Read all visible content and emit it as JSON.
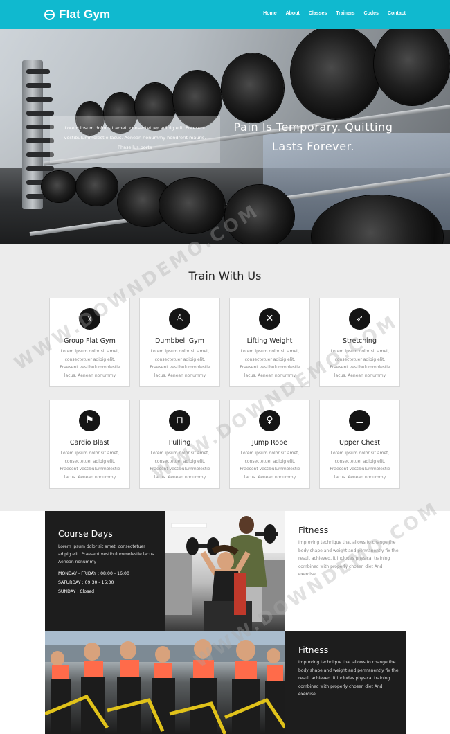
{
  "brand": {
    "name": "Flat Gym",
    "icon": "dumbbell-icon"
  },
  "nav": [
    {
      "label": "Home"
    },
    {
      "label": "About"
    },
    {
      "label": "Classes"
    },
    {
      "label": "Trainers"
    },
    {
      "label": "Codes"
    },
    {
      "label": "Contact"
    }
  ],
  "hero": {
    "box_text": "Lorem ipsum dolor sit amet, consectetuer adipig elit. Praesent vestibulummolestie lacus. Aenean nonummy hendrerit mauris. Phasellus porta",
    "quote_line1": "Pain Is Temporary. Quitting",
    "quote_line2": "Lasts Forever."
  },
  "train": {
    "title": "Train With Us",
    "cards": [
      {
        "title": "Group Flat Gym",
        "icon": "group-workout-icon",
        "glyph": "⚹",
        "text": "Lorem ipsum dolor sit amet, consectetuer adipig elit. Praesent vestibulummolestie lacus. Aenean nonummy"
      },
      {
        "title": "Dumbbell Gym",
        "icon": "dumbbell-person-icon",
        "glyph": "♙",
        "text": "Lorem ipsum dolor sit amet, consectetuer adipig elit. Praesent vestibulummolestie lacus. Aenean nonummy"
      },
      {
        "title": "Lifting Weight",
        "icon": "weightlifting-icon",
        "glyph": "✕",
        "text": "Lorem ipsum dolor sit amet, consectetuer adipig elit. Praesent vestibulummolestie lacus. Aenean nonummy"
      },
      {
        "title": "Stretching",
        "icon": "stretching-icon",
        "glyph": "➶",
        "text": "Lorem ipsum dolor sit amet, consectetuer adipig elit. Praesent vestibulummolestie lacus. Aenean nonummy"
      },
      {
        "title": "Cardio Blast",
        "icon": "treadmill-icon",
        "glyph": "⚑",
        "text": "Lorem ipsum dolor sit amet, consectetuer adipig elit. Praesent vestibulummolestie lacus. Aenean nonummy"
      },
      {
        "title": "Pulling",
        "icon": "pull-up-icon",
        "glyph": "⊓",
        "text": "Lorem ipsum dolor sit amet, consectetuer adipig elit. Praesent vestibulummolestie lacus. Aenean nonummy"
      },
      {
        "title": "Jump Rope",
        "icon": "jump-rope-icon",
        "glyph": "♀",
        "text": "Lorem ipsum dolor sit amet, consectetuer adipig elit. Praesent vestibulummolestie lacus. Aenean nonummy"
      },
      {
        "title": "Upper Chest",
        "icon": "bench-press-icon",
        "glyph": "⚊",
        "text": "Lorem ipsum dolor sit amet, consectetuer adipig elit. Praesent vestibulummolestie lacus. Aenean nonummy"
      }
    ]
  },
  "course": {
    "title": "Course Days",
    "text": "Lorem ipsum dolor sit amet, consectetuer adipig elit. Praesent vestibulummolestie lacus. Aenean nonummy",
    "hours": [
      "MONDAY - FRIDAY : 08:00 - 16:00",
      "SATURDAY : 09:30 - 15:30",
      "SUNDAY : Closed"
    ]
  },
  "fitness1": {
    "title": "Fitness",
    "text": "Improving technique that allows to change the body shape and weight and permanently fix the result achieved, it includes physical training combined with properly chosen diet And exercise."
  },
  "fitness2": {
    "title": "Fitness",
    "text": "Improving technique that allows to change the body shape and weight and permanently fix the result achieved. it includes physical training combined with properly chosen diet And exercise."
  },
  "watermark": "WWW.DOWNDEMO.COM",
  "colors": {
    "accent": "#10b9cf",
    "dark": "#1d1d1d",
    "section_bg": "#ececec"
  }
}
